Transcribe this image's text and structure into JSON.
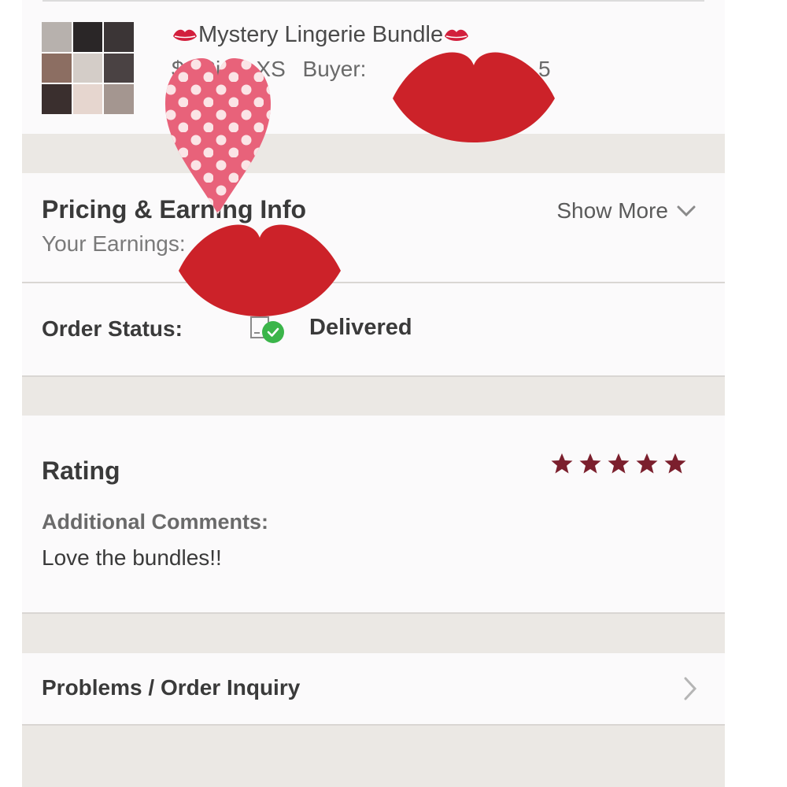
{
  "item": {
    "title": "Mystery Lingerie Bundle",
    "price_partial": "$",
    "size": "Size: XS",
    "buyer": "Buyer: ",
    "buyer_tail": "5"
  },
  "pricing": {
    "title": "Pricing & Earning Info",
    "earnings_label": "Your Earnings:",
    "show_more": "Show More"
  },
  "order_status": {
    "label": "Order Status:",
    "value": "Delivered"
  },
  "rating": {
    "title": "Rating",
    "stars": 5,
    "comments_label": "Additional Comments:",
    "comments": "Love the bundles!!"
  },
  "problems": {
    "label": "Problems / Order Inquiry"
  },
  "icons": {
    "kiss": "lips-kiss-emoji",
    "show_more": "chevron-down-icon",
    "status": "package-check-icon",
    "star": "star-icon",
    "problems": "chevron-right-icon"
  },
  "colors": {
    "accent_star": "#7b1f2d",
    "check": "#3bb54a",
    "lips": "#cc2229",
    "heart": "#e8627a"
  }
}
